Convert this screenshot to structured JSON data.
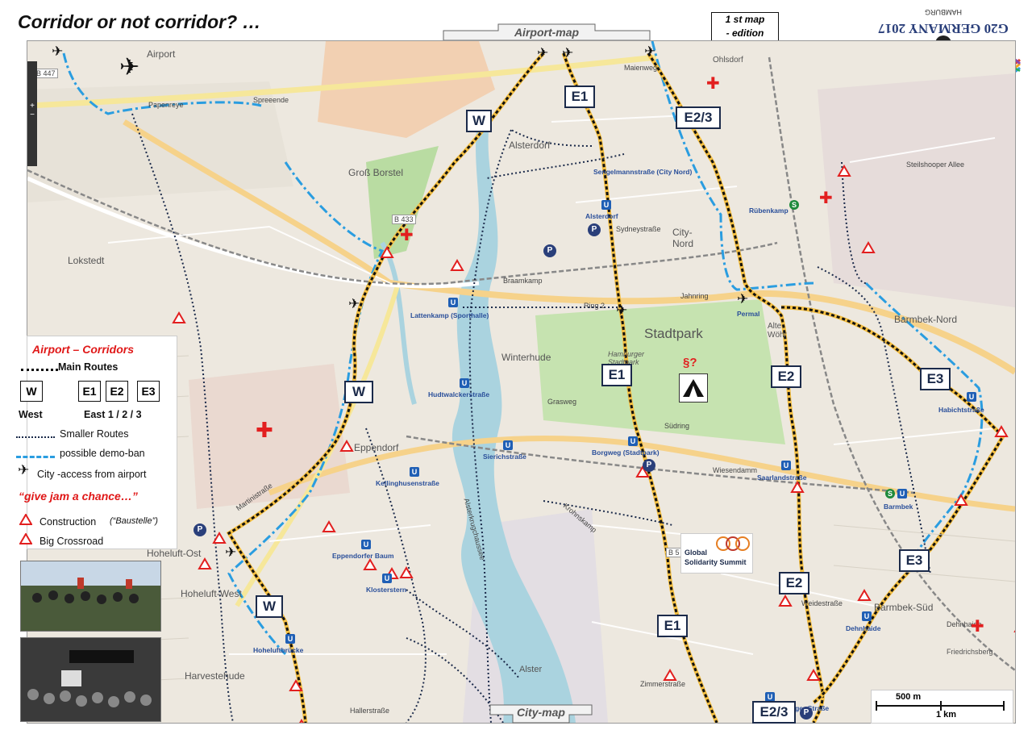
{
  "title": "Corridor or not corridor? …",
  "top_tab": "Airport-map",
  "bottom_tab": "City-map",
  "edition": {
    "line1": "1 st  map",
    "line2": "- edition"
  },
  "logo": {
    "text_main": "G20 GERMANY 2017",
    "text_sub": "HAMBURG",
    "badge": "HH"
  },
  "legend": {
    "title": "Airport – Corridors",
    "main_routes": "Main Routes",
    "boxes": [
      "W",
      "E1",
      "E2",
      "E3"
    ],
    "west": "West",
    "east": "East 1 / 2 / 3",
    "smaller_routes": "Smaller Routes",
    "demo_ban": "possible demo-ban",
    "city_access": "City -access from airport",
    "jam": "“give jam a chance…”",
    "construction": "Construction",
    "construction_note": "(“Baustelle”)",
    "crossroad": "Big Crossroad"
  },
  "route_boxes": [
    {
      "id": "w-top",
      "label": "W"
    },
    {
      "id": "w-mid",
      "label": "W"
    },
    {
      "id": "w-bot",
      "label": "W"
    },
    {
      "id": "e1-top",
      "label": "E1"
    },
    {
      "id": "e1-mid",
      "label": "E1"
    },
    {
      "id": "e1-bot",
      "label": "E1"
    },
    {
      "id": "e23-top",
      "label": "E2/3"
    },
    {
      "id": "e2-mid",
      "label": "E2"
    },
    {
      "id": "e2-bot",
      "label": "E2"
    },
    {
      "id": "e3-mid",
      "label": "E3"
    },
    {
      "id": "e3-bot",
      "label": "E3"
    },
    {
      "id": "e23-bot",
      "label": "E2/3"
    }
  ],
  "districts": [
    "Airport",
    "Groß Borstel",
    "Lokstedt",
    "Alsterdorf",
    "City-Nord",
    "Stadtpark",
    "Winterhude",
    "Eppendorf",
    "Hoheluft-Ost",
    "Hoheluft-West",
    "Harvestehude",
    "Barmbek-Nord",
    "Barmbek-Süd",
    "Ohlsdorf",
    "Alte Wöhr",
    "Alster",
    "Hamburger Stadtpark",
    "Friedrichsberg"
  ],
  "stations": [
    "Sengelmannstraße (City Nord)",
    "Alsterdorf",
    "Rübenkamp",
    "Lattenkamp (Sporthalle)",
    "Hudtwalckerstraße",
    "Sierichstraße",
    "Borgweg (Stadtpark)",
    "Saarlandstraße",
    "Kellinghusenstraße",
    "Eppendorfer Baum",
    "Klosterstern",
    "Hoheluftbrücke",
    "Habichtstraße",
    "Barmbek",
    "Dehnhaide",
    "Hamburger Straße",
    "Permal"
  ],
  "streets": [
    "Papenreye",
    "Spreeende",
    "Braamkamp",
    "Jahnring",
    "Ring 2",
    "Südring",
    "Wiesendamm",
    "Martinistraße",
    "Hallerstraße",
    "Maienweg",
    "Sydneystraße",
    "Steilshooper Allee",
    "Grasweg",
    "Zimmerstraße",
    "Weidestraße",
    "Dehnhaide",
    "B 433",
    "B 447",
    "B 5",
    "Krohnskamp",
    "Alsterkrugchaussee"
  ],
  "summit": {
    "line1": "Global",
    "line2": "Solidarity Summit"
  },
  "misc": {
    "paragraph": "§?"
  },
  "scale": {
    "short": "500 m",
    "long": "1 km"
  },
  "colors": {
    "route": "#111111",
    "route_fill": "#f5c043",
    "demo_ban": "#2a9de0",
    "cross": "#e21f1f",
    "box_border": "#1b2a4a",
    "legend_red": "#e01818"
  }
}
